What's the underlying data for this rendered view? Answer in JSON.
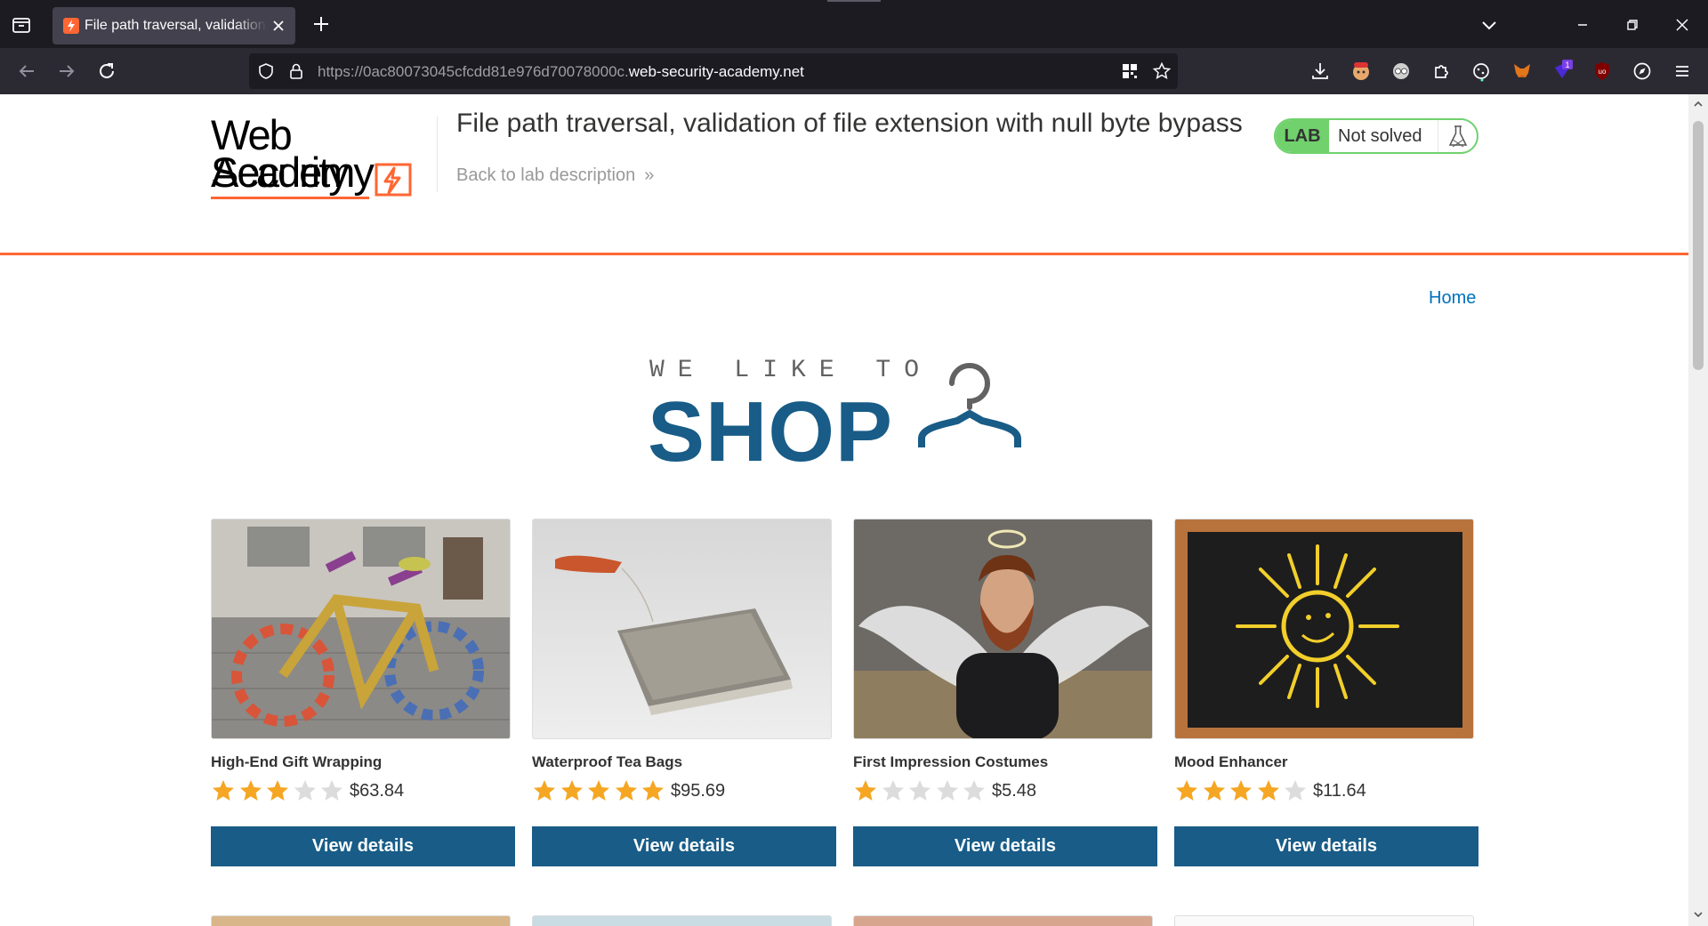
{
  "browser": {
    "tab_title": "File path traversal, validation of file extension with null byte bypass",
    "url_prefix": "https://0ac80073045cfcdd81e976d70078000c.",
    "url_domain": "web-security-academy.net"
  },
  "header": {
    "logo_line1": "Web Security",
    "logo_line2": "Academy",
    "lab_title": "File path traversal, validation of file extension with null byte bypass",
    "back_link": "Back to lab description",
    "back_chevron": "»",
    "lab_badge": "LAB",
    "lab_status": "Not solved"
  },
  "nav": {
    "home": "Home"
  },
  "shop_logo": {
    "small": "WE LIKE TO",
    "big": "SHOP"
  },
  "colors": {
    "accent_orange": "#ff6633",
    "button_blue": "#185c87",
    "lab_green": "#70d16d",
    "star_gold": "#f5a623",
    "star_empty": "#dcdcdc",
    "link_blue": "#0071bc"
  },
  "products": [
    {
      "name": "High-End Gift Wrapping",
      "rating": 3,
      "price": "$63.84",
      "button": "View details"
    },
    {
      "name": "Waterproof Tea Bags",
      "rating": 5,
      "price": "$95.69",
      "button": "View details"
    },
    {
      "name": "First Impression Costumes",
      "rating": 1,
      "price": "$5.48",
      "button": "View details"
    },
    {
      "name": "Mood Enhancer",
      "rating": 4,
      "price": "$11.64",
      "button": "View details"
    }
  ]
}
